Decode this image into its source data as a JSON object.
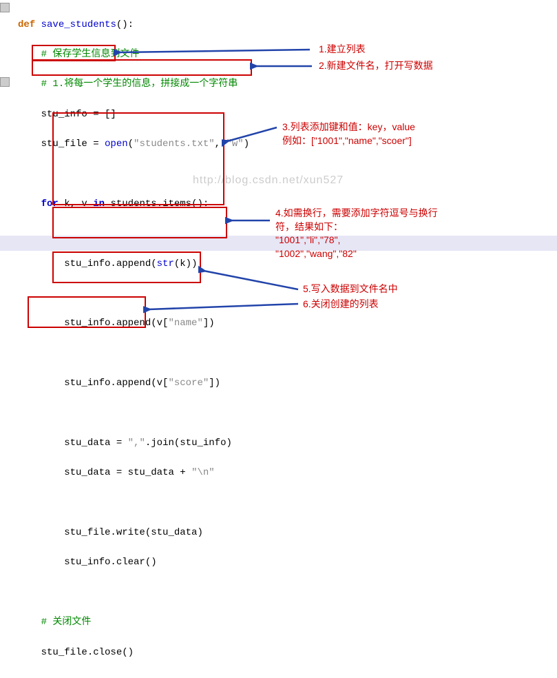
{
  "code": {
    "l1": {
      "def": "def",
      "fn": "save_students",
      "paren": "():"
    },
    "l2": "# 保存学生信息到文件",
    "l3": "# 1.将每一个学生的信息，拼接成一个字符串",
    "l4": {
      "a": "stu_info = []"
    },
    "l5": {
      "a": "stu_file = ",
      "b": "open",
      "c": "(",
      "s1": "\"students.txt\"",
      "d": ", ",
      "s2": "\"w\"",
      "e": ")"
    },
    "l7": {
      "a": "for",
      "b": " k, v ",
      "c": "in",
      "d": " students.items():"
    },
    "l9": {
      "a": "stu_info.append(",
      "b": "str",
      "c": "(k))"
    },
    "l11": {
      "a": "stu_info.append(v[",
      "s": "\"name\"",
      "b": "])"
    },
    "l13": {
      "a": "stu_info.append(v[",
      "s": "\"score\"",
      "b": "])"
    },
    "l15": {
      "a": "stu_data = ",
      "s": "\",\"",
      "b": ".join(stu_info)"
    },
    "l16": {
      "a": "stu_data = stu_data + ",
      "s": "\"\\n\""
    },
    "l18": {
      "a": "stu_file.write(stu_data)"
    },
    "l19": {
      "a": "stu_info.clear()"
    },
    "l21": "# 关闭文件",
    "l22": {
      "a": "stu_file.close()"
    }
  },
  "annotations": {
    "a1": "1.建立列表",
    "a2": "2.新建文件名，打开写数据",
    "a3a": "3.列表添加键和值：key，value",
    "a3b": "例如：[\"1001\",\"name\",\"scoer\"]",
    "a4a": "4.如需换行，需要添加字符逗号与换行",
    "a4b": "符，结果如下：",
    "a4c": "\"1001\",\"li\",\"78\",",
    "a4d": "\"1002\",\"wang\",\"82\"",
    "a5": "5.写入数据到文件名中",
    "a6": "6.关闭创建的列表"
  },
  "watermark": "http://blog.csdn.net/xun527"
}
